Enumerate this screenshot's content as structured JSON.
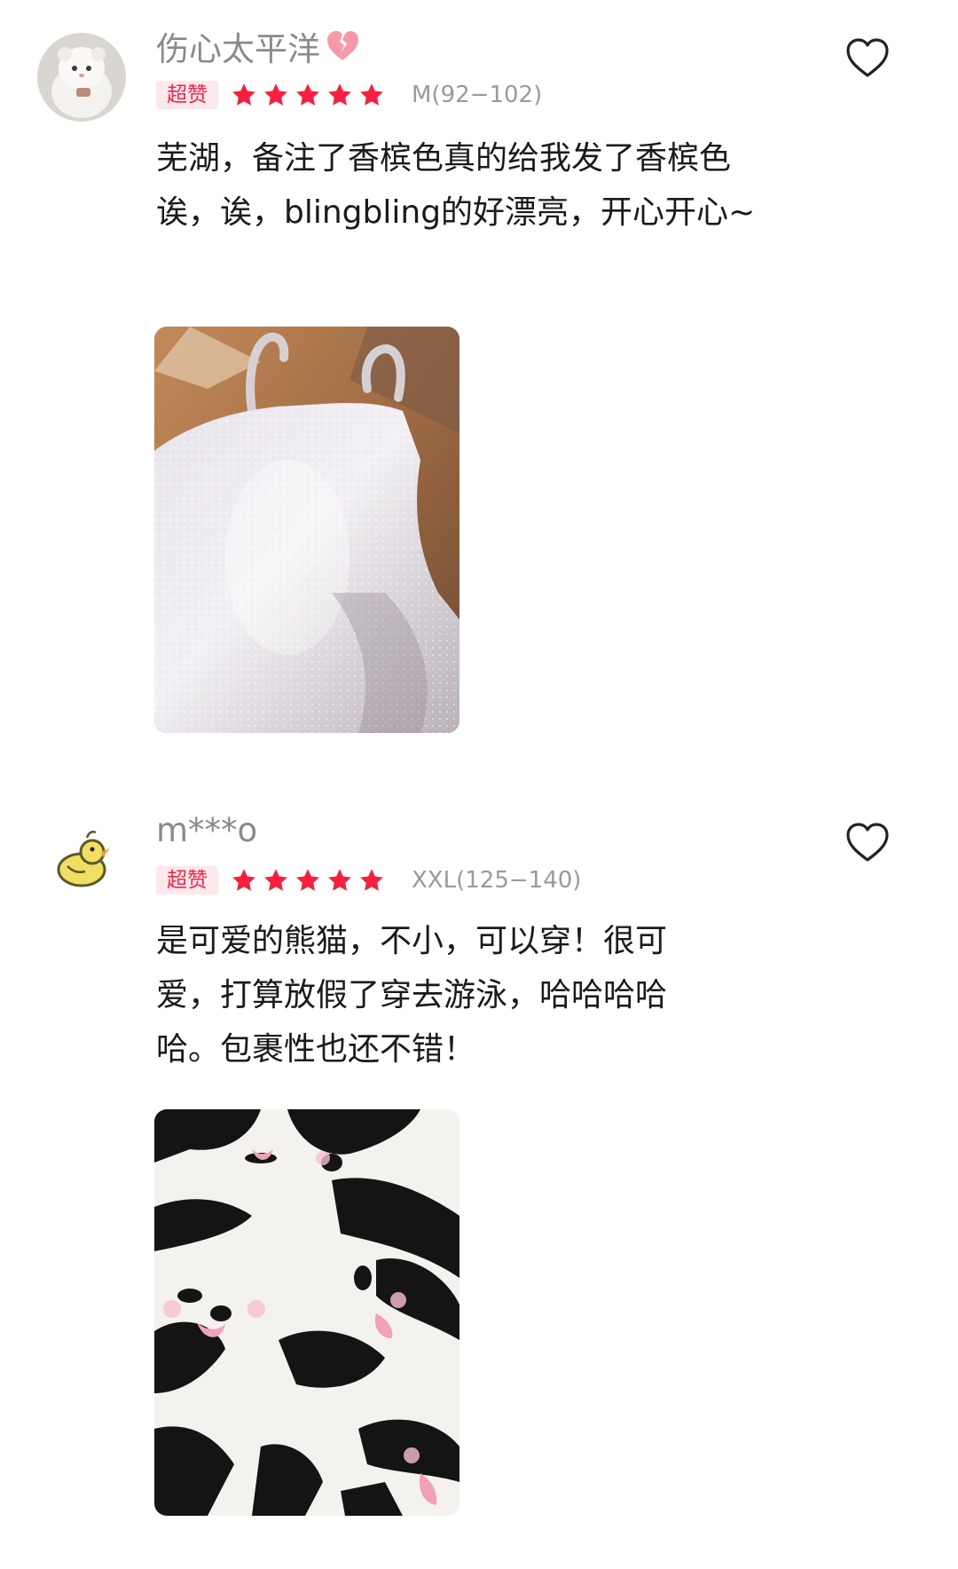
{
  "reviews": [
    {
      "username": "伤心太平洋",
      "username_emoji": "broken-heart-icon",
      "badge": "超赞",
      "rating": 5,
      "size": "M(92−102)",
      "comment": "芜湖，备注了香槟色真的给我发了香槟色诶，诶，blingbling的好漂亮，开心开心~",
      "avatar_icon": "white-cat-avatar",
      "photo_icon": "sparkly-champagne-swimsuit-photo"
    },
    {
      "username": "m***o",
      "badge": "超赞",
      "rating": 5,
      "size": "XXL(125−140)",
      "comment": "是可爱的熊猫，不小，可以穿！很可爱，打算放假了穿去游泳，哈哈哈哈哈。包裹性也还不错！",
      "avatar_icon": "yellow-chick-avatar",
      "photo_icon": "panda-print-fabric-photo"
    }
  ],
  "colors": {
    "badge_text": "#f0264a",
    "badge_bg": "#fde8ec",
    "star": "#f5203f",
    "username": "#8a8a8a",
    "size_text": "#9a9a9a"
  }
}
